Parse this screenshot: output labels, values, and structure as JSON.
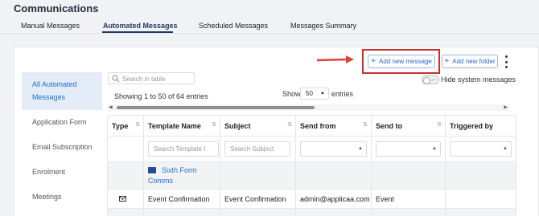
{
  "page_title": "Communications",
  "tabs": [
    {
      "label": "Manual Messages"
    },
    {
      "label": "Automated Messages"
    },
    {
      "label": "Scheduled Messages"
    },
    {
      "label": "Messages Summary"
    }
  ],
  "sidebar": {
    "items": [
      {
        "label": "All Automated Messages"
      },
      {
        "label": "Application Form"
      },
      {
        "label": "Email Subscription"
      },
      {
        "label": "Enrolment"
      },
      {
        "label": "Meetings"
      }
    ]
  },
  "toolbar": {
    "add_message_label": "Add new message",
    "add_folder_label": "Add new folder",
    "hide_system_label": "Hide system messages",
    "toggle_text": "OFF"
  },
  "search": {
    "placeholder": "Search in table"
  },
  "pagination": {
    "showing_text": "Showing 1 to 50 of 64 entries",
    "show_label": "Show",
    "page_size": "50",
    "entries_label": "entries"
  },
  "table": {
    "columns": [
      {
        "label": "Type"
      },
      {
        "label": "Template Name"
      },
      {
        "label": "Subject"
      },
      {
        "label": "Send from"
      },
      {
        "label": "Send to"
      },
      {
        "label": "Triggered by"
      }
    ],
    "filters": {
      "template_placeholder": "Search Template I",
      "subject_placeholder": "Search Subject"
    },
    "folder_row": {
      "name": "Sixth Form Comms"
    },
    "rows": [
      {
        "type_icon": "mail-icon",
        "template": "Event Confirmation",
        "subject": "Event Confirmation",
        "send_from": "admin@applicaa.com",
        "send_to": "Event",
        "triggered_by": ""
      }
    ]
  },
  "colors": {
    "accent": "#1e6fd3",
    "highlight_box": "#c9302c",
    "arrow": "#d9463a"
  }
}
